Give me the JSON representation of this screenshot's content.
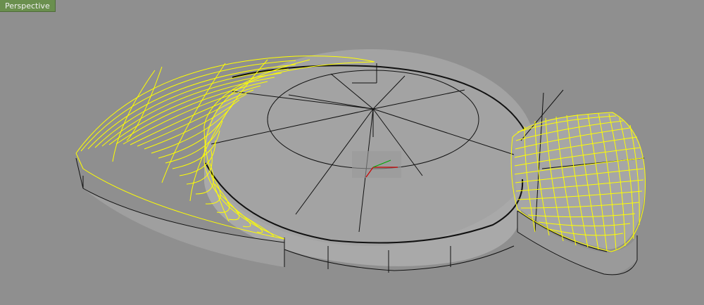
{
  "viewport": {
    "title": "Perspective",
    "colors": {
      "background": "#8f8f8f",
      "tab": "#6a8f4e",
      "tab_text": "#f2f2f2",
      "edge": "#111111",
      "isocurve": "#ffff00",
      "axis_x": "#cc0000",
      "axis_y": "#00aa00"
    }
  }
}
